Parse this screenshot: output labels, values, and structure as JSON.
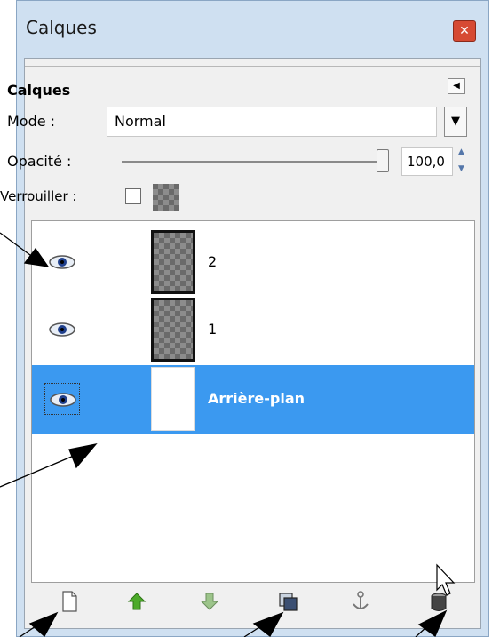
{
  "window": {
    "title": "Calques",
    "close_icon": "close-icon"
  },
  "panel": {
    "title": "Calques",
    "mode": {
      "label": "Mode :",
      "value": "Normal"
    },
    "opacity": {
      "label": "Opacité :",
      "value": "100,0",
      "percent": 100
    },
    "lock": {
      "label": "Verrouiller :",
      "checked": false
    }
  },
  "layers": [
    {
      "name": "2",
      "visible": true,
      "selected": false,
      "thumb": "transparent"
    },
    {
      "name": "1",
      "visible": true,
      "selected": false,
      "thumb": "transparent"
    },
    {
      "name": "Arrière-plan",
      "visible": true,
      "selected": true,
      "thumb": "white"
    }
  ],
  "toolbar": {
    "buttons": [
      {
        "icon": "new-layer-icon"
      },
      {
        "icon": "raise-layer-icon"
      },
      {
        "icon": "lower-layer-icon"
      },
      {
        "icon": "duplicate-layer-icon"
      },
      {
        "icon": "anchor-layer-icon"
      },
      {
        "icon": "delete-layer-icon"
      }
    ]
  },
  "colors": {
    "selection": "#3b99f0",
    "window_frame": "#cfe0f1",
    "close_button": "#d64a33"
  }
}
